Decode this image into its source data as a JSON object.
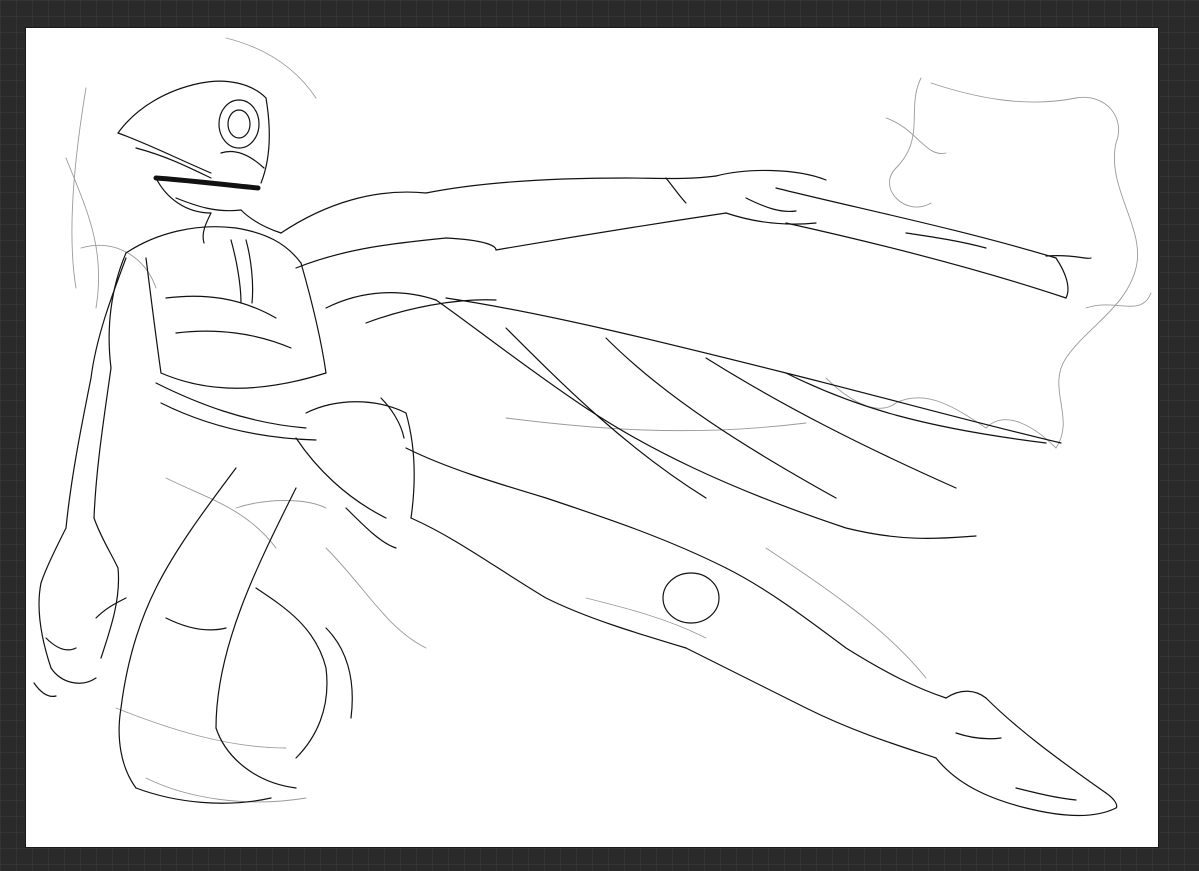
{
  "app": {
    "workspace_background": "#2a2a2a",
    "canvas_background": "#ffffff",
    "ink_color": "#111111",
    "construction_color": "#9a9a9a"
  },
  "canvas": {
    "content": "sketch-figure-drawing"
  }
}
